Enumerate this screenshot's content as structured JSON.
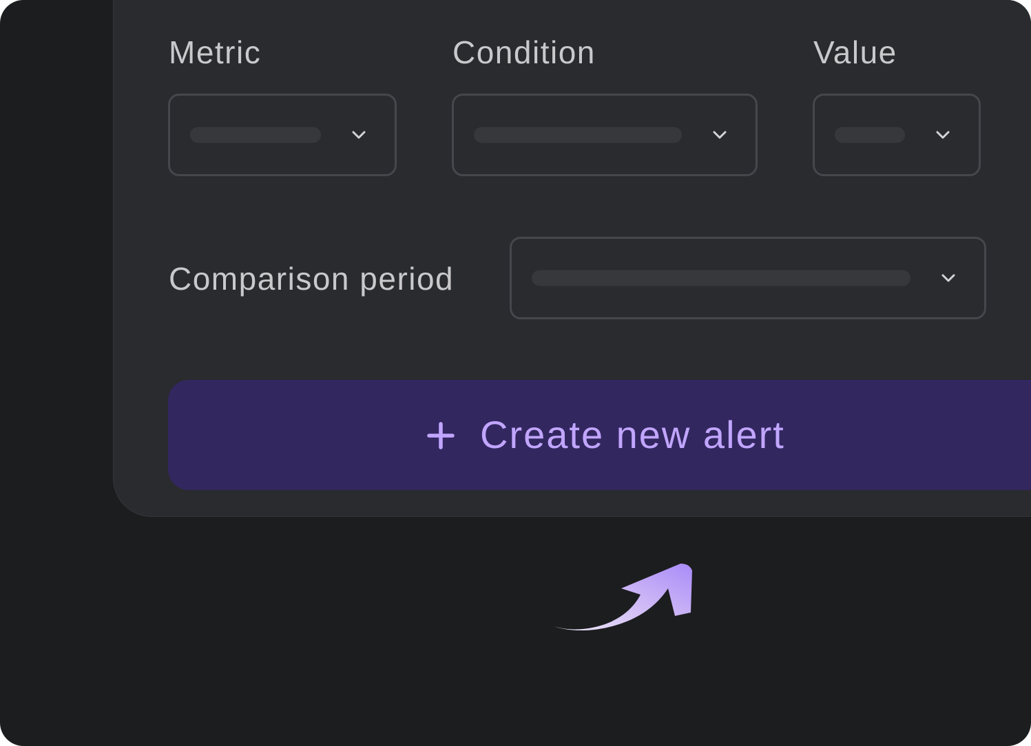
{
  "form": {
    "metric_label": "Metric",
    "condition_label": "Condition",
    "value_label": "Value",
    "comparison_period_label": "Comparison period"
  },
  "selects": {
    "metric": {
      "icon": "chevron-down-icon"
    },
    "condition": {
      "icon": "chevron-down-icon"
    },
    "value": {
      "icon": "chevron-down-icon"
    },
    "comparison_period": {
      "icon": "chevron-down-icon"
    }
  },
  "create_button": {
    "label": "Create new alert",
    "icon": "plus-icon"
  },
  "decoration": {
    "arrow_icon": "curved-arrow-icon"
  },
  "colors": {
    "background": "#1c1d1f",
    "panel": "#2a2b2e",
    "field_border": "#46474c",
    "placeholder_bar": "#37383c",
    "label_text": "#c9c9cc",
    "button_background": "#332760",
    "button_accent": "#c1a6ff"
  }
}
